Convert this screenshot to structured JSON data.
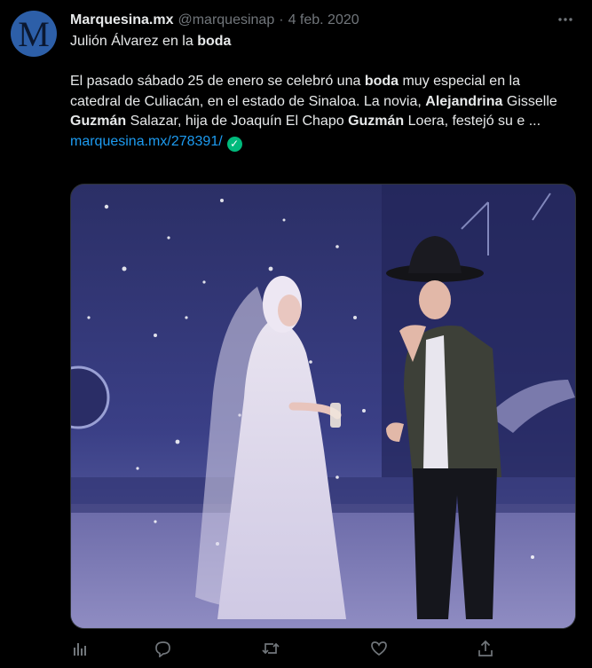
{
  "author": {
    "avatar_letter": "M",
    "name": "Marquesina.mx",
    "handle": "@marquesinap",
    "separator": "·",
    "date": "4 feb. 2020"
  },
  "tweet": {
    "title_pre": "Julión Álvarez en la ",
    "title_bold": "boda",
    "body": {
      "s1": "El pasado sábado 25 de enero se celebró una ",
      "b1": "boda",
      "s2": " muy especial en la catedral de Culiacán, en el estado de Sinaloa. La novia, ",
      "b2": "Alejandrina",
      "s3": " Gisselle ",
      "b3": "Guzmán",
      "s4": " Salazar, hija de Joaquín El Chapo ",
      "b4": "Guzmán",
      "s5": " Loera, festejó su e ..."
    },
    "link": "marquesina.mx/278391/"
  },
  "media": {
    "description_icon": "photo"
  },
  "colors": {
    "background": "#000000",
    "text": "#e7e9ea",
    "muted": "#71767b",
    "link": "#1d9bf0",
    "verified": "#00ba7c"
  },
  "actions": {
    "icons": [
      "analytics-icon",
      "reply-icon",
      "retweet-icon",
      "like-icon",
      "share-icon"
    ]
  }
}
